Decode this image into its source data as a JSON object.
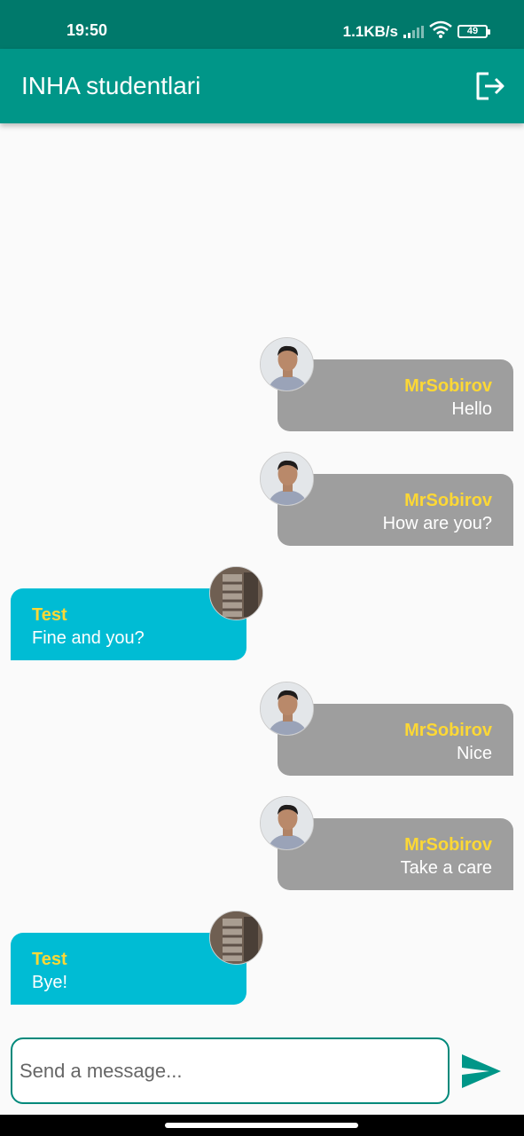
{
  "status_bar": {
    "time": "19:50",
    "network_speed": "1.1KB/s",
    "battery_level": "49",
    "icons": [
      "signal-icon",
      "wifi-icon",
      "battery-icon"
    ]
  },
  "app_bar": {
    "title": "INHA studentlari",
    "logout_icon": "logout-icon"
  },
  "messages": [
    {
      "sender": "MrSobirov",
      "text": "Hello",
      "mine": true
    },
    {
      "sender": "MrSobirov",
      "text": "How are you?",
      "mine": true
    },
    {
      "sender": "Test",
      "text": "Fine and you?",
      "mine": false
    },
    {
      "sender": "MrSobirov",
      "text": "Nice",
      "mine": true
    },
    {
      "sender": "MrSobirov",
      "text": "Take a care",
      "mine": true
    },
    {
      "sender": "Test",
      "text": "Bye!",
      "mine": false
    }
  ],
  "composer": {
    "placeholder": "Send a message...",
    "send_icon": "send-icon"
  },
  "colors": {
    "status_bar": "#00796b",
    "app_bar": "#009688",
    "my_bubble": "#9e9e9e",
    "their_bubble": "#00bcd4",
    "sender_name": "#fdd835",
    "input_border": "#00897b"
  }
}
